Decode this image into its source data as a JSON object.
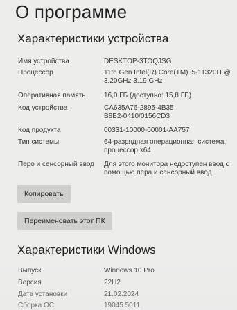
{
  "page": {
    "title": "О программе"
  },
  "device_specs": {
    "heading": "Характеристики устройства",
    "rows": [
      {
        "label": "Имя устройства",
        "value": "DESKTOP-3TOQJSG"
      },
      {
        "label": "Процессор",
        "value": "11th Gen Intel(R) Core(TM) i5-11320H @\n3.20GHz   3.19 GHz"
      },
      {
        "label": "Оперативная память",
        "value": "16,0 ГБ (доступно: 15,8 ГБ)"
      },
      {
        "label": "Код устройства",
        "value": "CA635A76-2895-4B35\nB8B2-0410/0156CD3"
      },
      {
        "label": "Код продукта",
        "value": "00331-10000-00001-AA757"
      },
      {
        "label": "Тип системы",
        "value": "64-разрядная операционная система,\nпроцессор x64"
      },
      {
        "label": "Перо и сенсорный ввод",
        "value": "Для этого монитора недоступен ввод с\nпомощью пера и сенсорный ввод"
      }
    ],
    "copy_button": "Копировать",
    "rename_button": "Переименовать этот ПК"
  },
  "windows_specs": {
    "heading": "Характеристики Windows",
    "rows": [
      {
        "label": "Выпуск",
        "value": "Windows 10 Pro"
      },
      {
        "label": "Версия",
        "value": "22H2"
      },
      {
        "label": "Дата установки",
        "value": "21.02.2024"
      },
      {
        "label": "Сборка ОС",
        "value": "19045.5011"
      }
    ]
  },
  "colors": {
    "background": "#ededec",
    "button": "#cfcfce",
    "text": "#2b2b2b"
  }
}
